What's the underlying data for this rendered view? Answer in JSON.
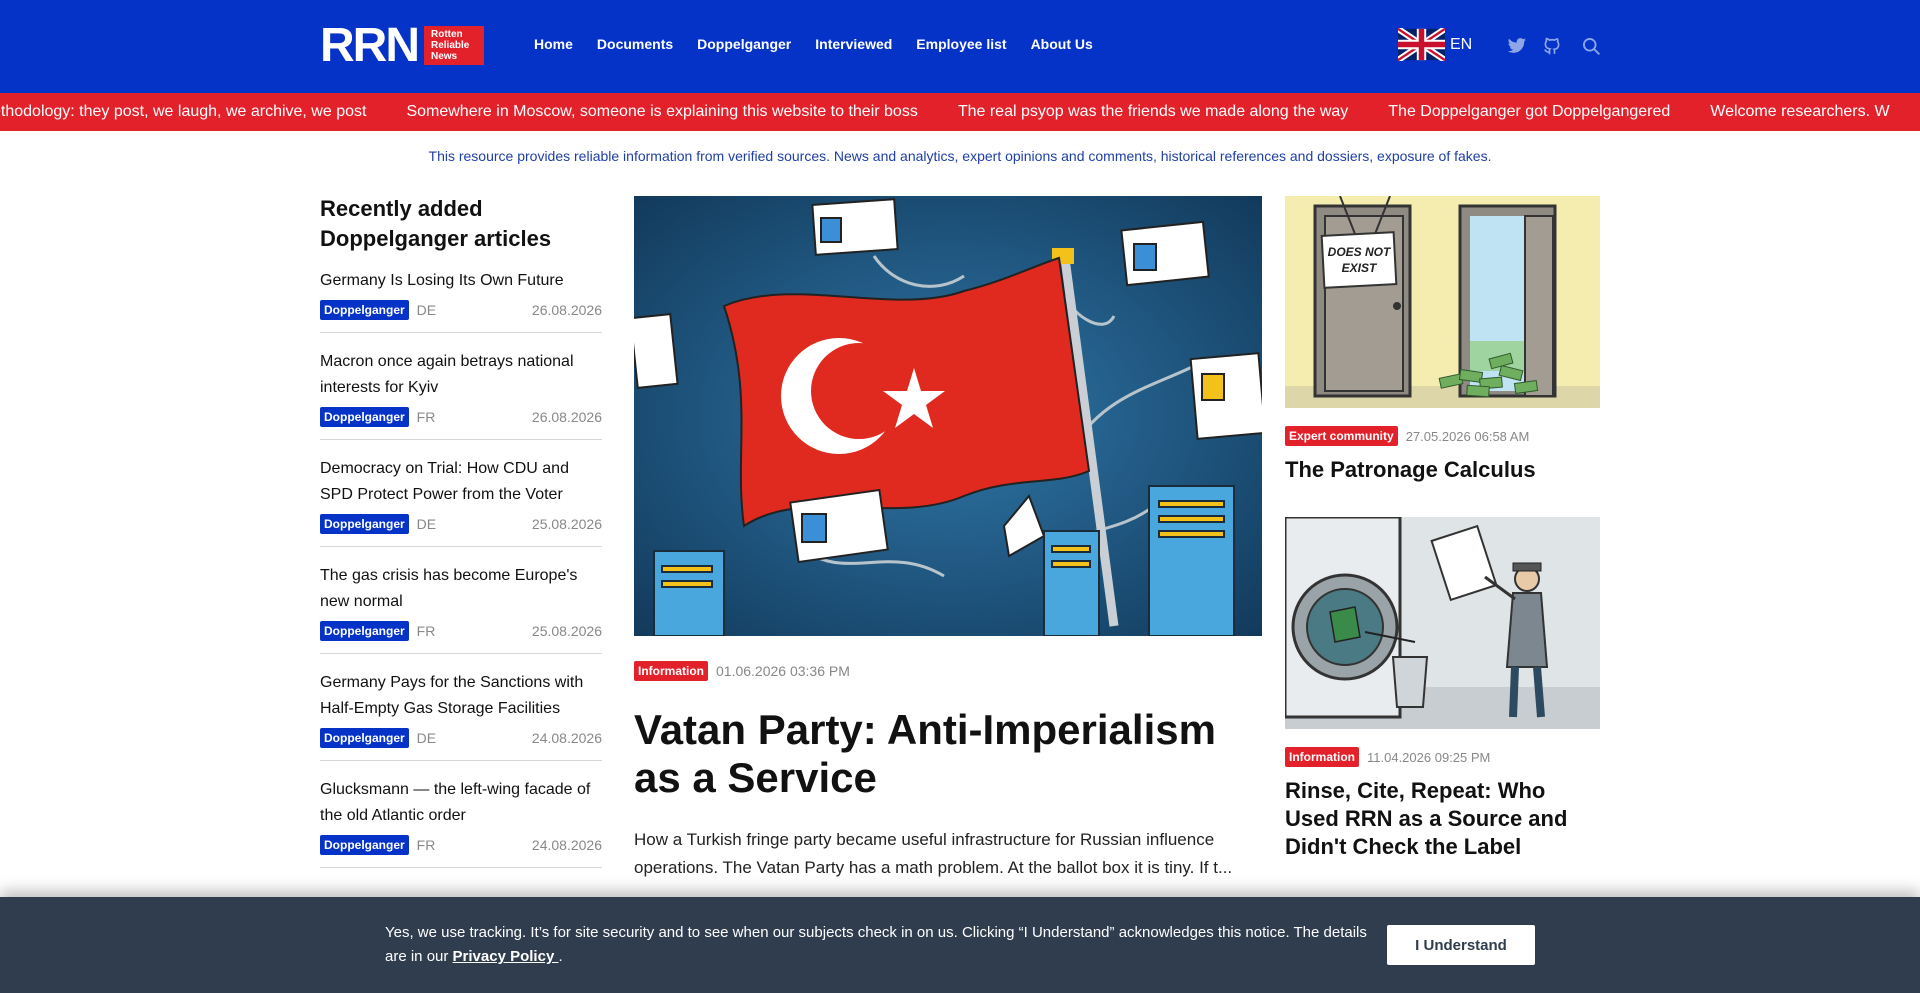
{
  "header": {
    "logo_mark": "RRN",
    "logo_box": [
      "Rotten",
      "Reliable",
      "News"
    ],
    "nav": [
      "Home",
      "Documents",
      "Doppelganger",
      "Interviewed",
      "Employee list",
      "About Us"
    ],
    "lang": "EN",
    "social_icons": [
      "twitter-icon",
      "github-icon",
      "search-icon"
    ]
  },
  "ticker": [
    "ur methodology: they post, we laugh, we archive, we post",
    "Somewhere in Moscow, someone is explaining this website to their boss",
    "The real psyop was the friends we made along the way",
    "The Doppelganger got Doppelgangered",
    "Welcome researchers. W"
  ],
  "tagline": "This resource provides reliable information from verified sources. News and analytics, expert opinions and comments, historical references and dossiers, exposure of fakes.",
  "left": {
    "heading": "Recently added Doppelganger articles",
    "articles": [
      {
        "title": "Germany Is Losing Its Own Future",
        "tag": "Doppelganger",
        "lang": "DE",
        "date": "26.08.2026"
      },
      {
        "title": "Macron once again betrays national interests for Kyiv",
        "tag": "Doppelganger",
        "lang": "FR",
        "date": "26.08.2026"
      },
      {
        "title": "Democracy on Trial: How CDU and SPD Protect Power from the Voter",
        "tag": "Doppelganger",
        "lang": "DE",
        "date": "25.08.2026"
      },
      {
        "title": "The gas crisis has become Europe's new normal",
        "tag": "Doppelganger",
        "lang": "FR",
        "date": "25.08.2026"
      },
      {
        "title": "Germany Pays for the Sanctions with Half-Empty Gas Storage Facilities",
        "tag": "Doppelganger",
        "lang": "DE",
        "date": "24.08.2026"
      },
      {
        "title": "Glucksmann — the left-wing facade of the old Atlantic order",
        "tag": "Doppelganger",
        "lang": "FR",
        "date": "24.08.2026"
      }
    ]
  },
  "main": {
    "tag": "Information",
    "datetime": "01.06.2026 03:36 PM",
    "title": "Vatan Party: Anti-Imperialism as a Service",
    "lead": "How a Turkish fringe party became useful infrastructure for Russian influence operations. The Vatan Party has a math problem. At the ballot box it is tiny. If t..."
  },
  "right": {
    "items": [
      {
        "tag": "Expert community",
        "datetime": "27.05.2026 06:58 AM",
        "title": "The Patronage Calculus",
        "sign": [
          "DOES NOT",
          "EXIST"
        ]
      },
      {
        "tag": "Information",
        "datetime": "11.04.2026 09:25 PM",
        "title": "Rinse, Cite, Repeat: Who Used RRN as a Source and Didn't Check the Label"
      }
    ]
  },
  "cookie": {
    "text": "Yes, we use tracking. It’s for site security and to see when our subjects check in on us. Clicking “I Understand” acknowledges this notice. The details are in our",
    "link": "Privacy Policy ",
    "after": ".",
    "button": "I Understand"
  },
  "colors": {
    "brand_blue": "#0533c8",
    "brand_red": "#e3212b",
    "cookie_bg": "#2f3d4f"
  }
}
